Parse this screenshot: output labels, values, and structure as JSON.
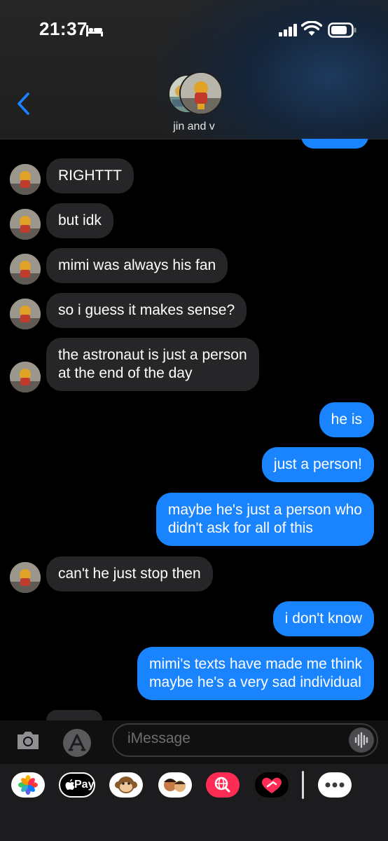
{
  "status_bar": {
    "time": "21:37"
  },
  "header": {
    "contact_name": "jin and v"
  },
  "messages": [
    {
      "sender": "them",
      "text": "RIGHTTT"
    },
    {
      "sender": "them",
      "text": "but idk"
    },
    {
      "sender": "them",
      "text": "mimi was always his fan"
    },
    {
      "sender": "them",
      "text": "so i guess it makes sense?"
    },
    {
      "sender": "them",
      "lines": [
        "the astronaut is just a person",
        "at the end of the day"
      ]
    },
    {
      "sender": "me",
      "text": "he is"
    },
    {
      "sender": "me",
      "text": "just a person!"
    },
    {
      "sender": "me",
      "lines": [
        "maybe he's just a person who",
        "didn't ask for all of this"
      ]
    },
    {
      "sender": "them",
      "text": "can't he just stop then"
    },
    {
      "sender": "me",
      "text": "i don't know"
    },
    {
      "sender": "me",
      "lines": [
        "mimi's texts have made me think",
        "maybe he's a very sad individual"
      ]
    }
  ],
  "input": {
    "placeholder": "iMessage"
  },
  "app_drawer": {
    "apple_pay_label": "Pay",
    "apps": [
      "photos-app",
      "apple-pay-app",
      "animoji-app",
      "memoji-app",
      "search-images-app",
      "digital-touch-app",
      "more-apps"
    ]
  },
  "colors": {
    "outgoing": "#1a84ff",
    "incoming": "#262628",
    "background": "#000000"
  }
}
